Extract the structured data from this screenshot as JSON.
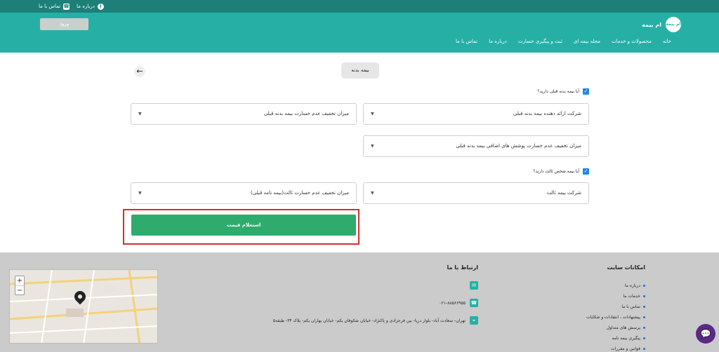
{
  "topbar": {
    "links": [
      {
        "label": "درباره ما",
        "icon": "info-icon"
      },
      {
        "label": "تماس با ما",
        "icon": "phone-icon"
      }
    ]
  },
  "header": {
    "brand_name": "ام بیمه",
    "logo_text": "ام بیمه",
    "login_label": "ورود",
    "nav": [
      "خانه",
      "محصولات و خدمات",
      "مجله بیمه ای",
      "ثبت و پیگیری خسارت",
      "درباره ما",
      "تماس با ما"
    ]
  },
  "main": {
    "tab_label": "بیمه بدنه",
    "back_icon": "arrow-left-icon",
    "q_prev_body": "آیا بیمه بدنه قبلی دارید؟",
    "sel_prev_insurer": "شرکت ارائه دهنده بیمه بدنه قبلی",
    "sel_body_discount": "میزان تخفیف عدم خسارت بیمه بدنه قبلی",
    "sel_extra_discount": "میزان تخفیف عدم خسارت پوشش های اضافی بیمه بدنه قبلی",
    "q_third_party": "آیا بیمه شخص ثالث دارید؟",
    "sel_third_insurer": "شرکت بیمه ثالث",
    "sel_third_discount": "میزان تخفیف عدم خسارت ثالث(بیمه نامه قبلی)",
    "submit_label": "استعلام قیمت"
  },
  "footer": {
    "site_title": "امکانات سایت",
    "site_links": [
      "درباره ما",
      "خدمات ما",
      "تماس با ما",
      "پیشنهادات ، انتقادات و شکایات",
      "پرسش های متداول",
      "پیگیری بیمه نامه",
      "قوانین و مقررات"
    ],
    "contact_title": "ارتباط با ما",
    "phone": "۰۲۱-۸۸۵۶۶۹۵۵",
    "address": "تهران- سعادت آباد- بلوار دریا- بین فرحزادی و پاکنژاد- خیابان شکوفان یکم- خیابان بهاران یکم- پلاک ۳۴- طبقه۵"
  },
  "colors": {
    "header": "#26b0a5",
    "topbar": "#1d7f78",
    "submit": "#2eac6d",
    "highlight": "#d32f2f",
    "checkbox": "#1e88e5",
    "footer": "#cbcbcb"
  }
}
